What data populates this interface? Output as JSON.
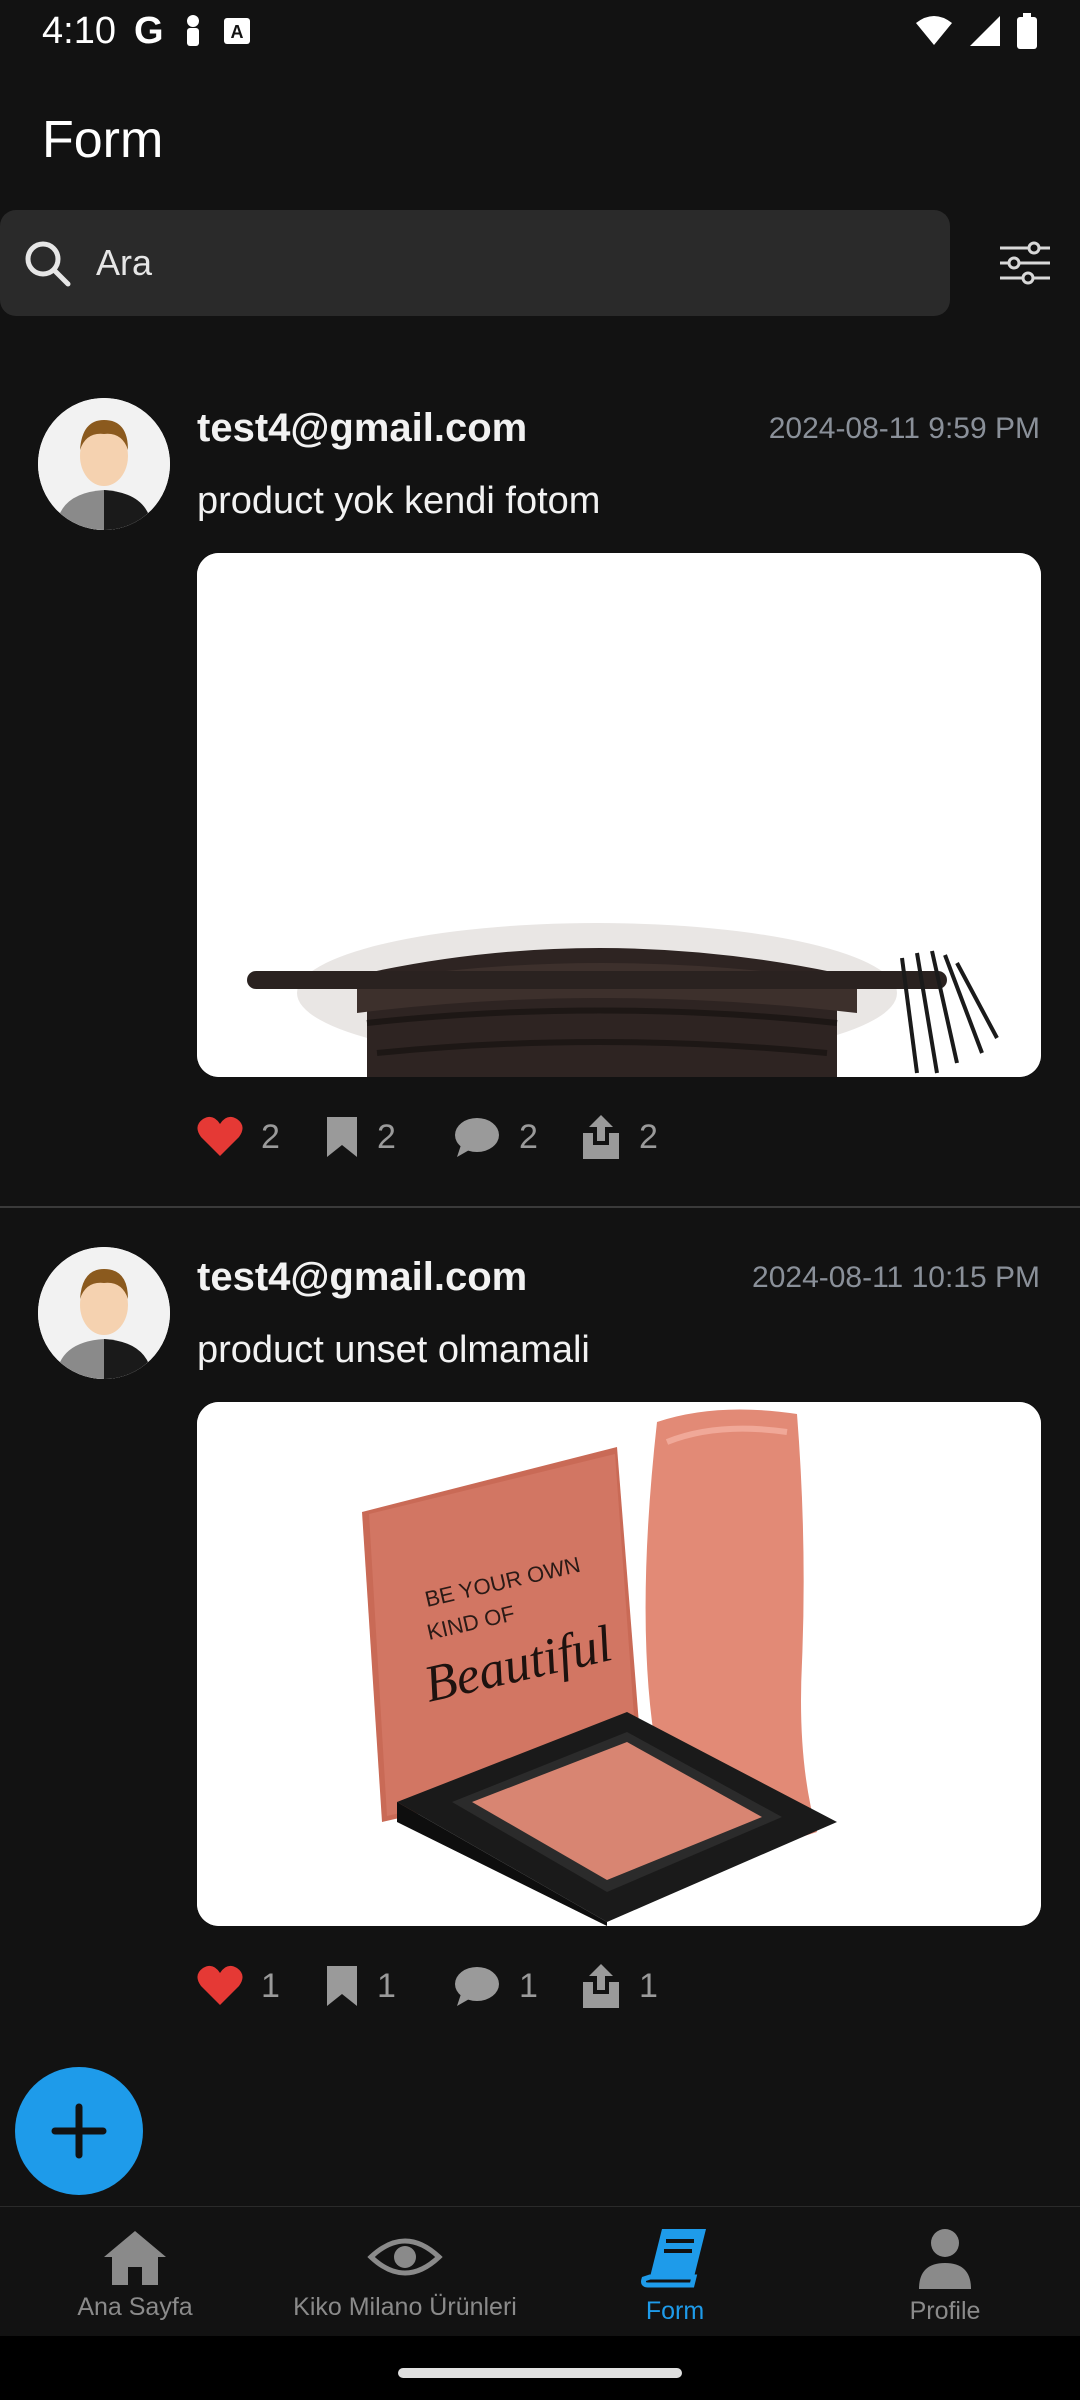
{
  "status_bar": {
    "time": "4:10",
    "g_label": "G"
  },
  "header": {
    "title": "Form"
  },
  "search": {
    "placeholder": "Ara"
  },
  "posts": [
    {
      "user": "test4@gmail.com",
      "timestamp": "2024-08-11 9:59 PM",
      "text": "product yok kendi fotom",
      "likes": "2",
      "bookmarks": "2",
      "comments": "2",
      "shares": "2"
    },
    {
      "user": "test4@gmail.com",
      "timestamp": "2024-08-11 10:15 PM",
      "text": "product unset olmamali",
      "likes": "1",
      "bookmarks": "1",
      "comments": "1",
      "shares": "1",
      "image_text_line1": "BE YOUR OWN",
      "image_text_line2": "KIND OF",
      "image_text_line3": "Beautiful"
    }
  ],
  "bottom_nav": {
    "items": [
      {
        "label": "Ana Sayfa",
        "icon": "home-icon"
      },
      {
        "label": "Kiko Milano Ürünleri",
        "icon": "eye-icon"
      },
      {
        "label": "Form",
        "icon": "book-icon",
        "active": true
      },
      {
        "label": "Profile",
        "icon": "person-icon"
      }
    ]
  },
  "colors": {
    "background": "#121212",
    "accent": "#1e9bea",
    "heart": "#e53935",
    "muted": "#9a9a9a"
  }
}
